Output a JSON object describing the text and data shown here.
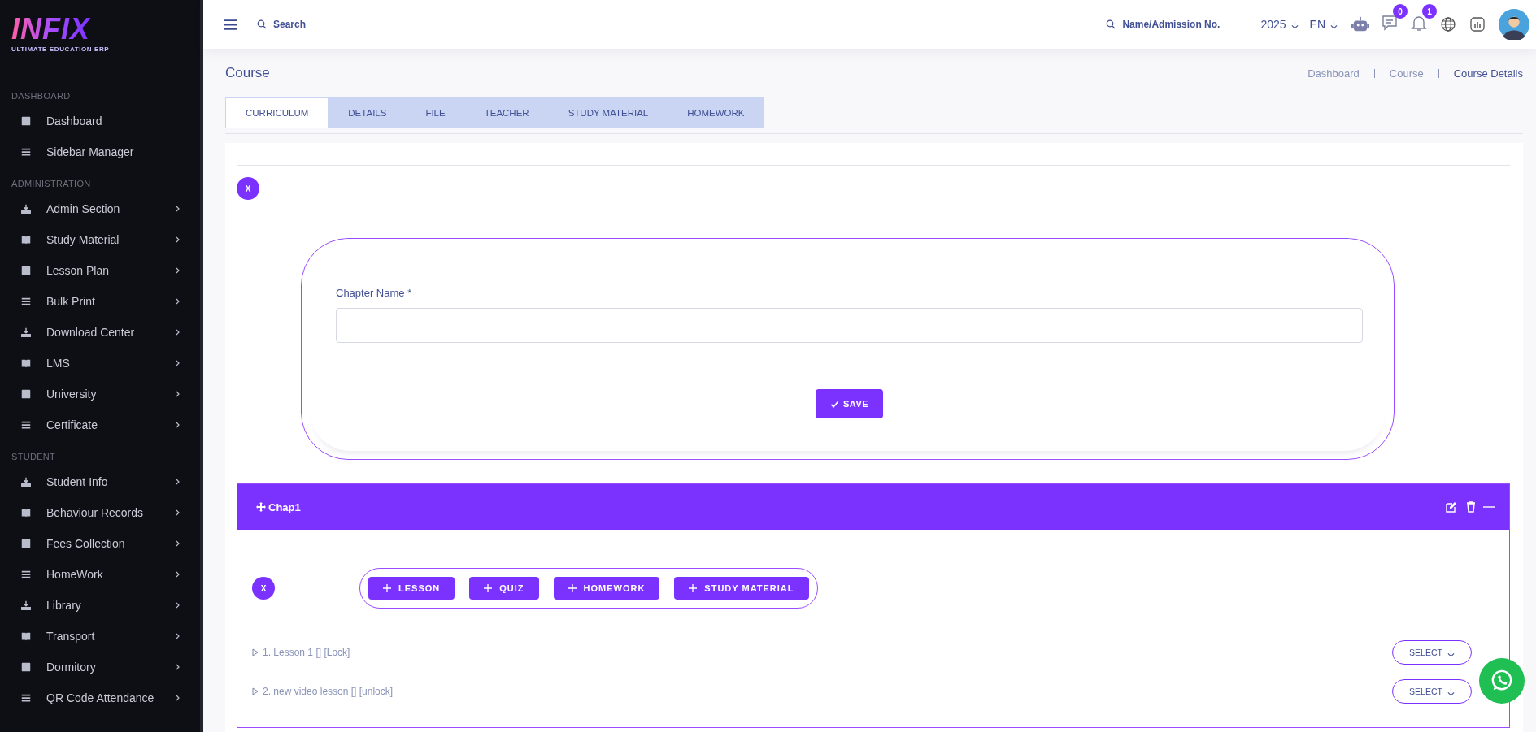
{
  "logo": {
    "name": "INFIX",
    "tagline": "ULTIMATE EDUCATION ERP"
  },
  "sidebar": {
    "sections": [
      {
        "title": "DASHBOARD",
        "items": [
          {
            "label": "Dashboard",
            "submenu": false
          },
          {
            "label": "Sidebar Manager",
            "submenu": false
          }
        ]
      },
      {
        "title": "ADMINISTRATION",
        "items": [
          {
            "label": "Admin Section",
            "submenu": true
          },
          {
            "label": "Study Material",
            "submenu": true
          },
          {
            "label": "Lesson Plan",
            "submenu": true
          },
          {
            "label": "Bulk Print",
            "submenu": true
          },
          {
            "label": "Download Center",
            "submenu": true
          },
          {
            "label": "LMS",
            "submenu": true
          },
          {
            "label": "University",
            "submenu": true
          },
          {
            "label": "Certificate",
            "submenu": true
          }
        ]
      },
      {
        "title": "STUDENT",
        "items": [
          {
            "label": "Student Info",
            "submenu": true
          },
          {
            "label": "Behaviour Records",
            "submenu": true
          },
          {
            "label": "Fees Collection",
            "submenu": true
          },
          {
            "label": "HomeWork",
            "submenu": true
          },
          {
            "label": "Library",
            "submenu": true
          },
          {
            "label": "Transport",
            "submenu": true
          },
          {
            "label": "Dormitory",
            "submenu": true
          },
          {
            "label": "QR Code Attendance",
            "submenu": true
          }
        ]
      }
    ]
  },
  "topbar": {
    "search": {
      "placeholder": "Search"
    },
    "admission_search": {
      "placeholder": "Name/Admission No."
    },
    "year": "2025",
    "language": "EN",
    "messages_count": "0",
    "notifications_count": "1"
  },
  "page_title": "Course",
  "breadcrumb": [
    {
      "label": "Dashboard",
      "current": false
    },
    {
      "label": "Course",
      "current": false
    },
    {
      "label": "Course Details",
      "current": true
    }
  ],
  "tabs": [
    {
      "label": "CURRICULUM",
      "selected": true
    },
    {
      "label": "DETAILS",
      "selected": false
    },
    {
      "label": "FILE",
      "selected": false
    },
    {
      "label": "TEACHER",
      "selected": false
    },
    {
      "label": "STUDY MATERIAL",
      "selected": false
    },
    {
      "label": "HOMEWORK",
      "selected": false
    }
  ],
  "close_button": "X",
  "chapter_form": {
    "label": "Chapter Name *",
    "save_button": "SAVE"
  },
  "chapter": {
    "title": "Chap1",
    "close_button": "X",
    "add_buttons": [
      "LESSON",
      "QUIZ",
      "HOMEWORK",
      "STUDY MATERIAL"
    ],
    "lessons": [
      {
        "title": "1. Lesson 1 [] [Lock]",
        "action": "SELECT"
      },
      {
        "title": "2. new video lesson [] [unlock]",
        "action": "SELECT"
      }
    ]
  }
}
